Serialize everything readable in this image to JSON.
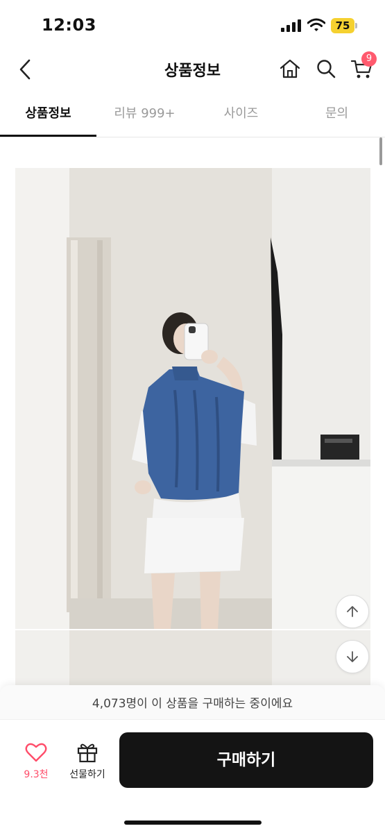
{
  "status_bar": {
    "time": "12:03",
    "battery": "75",
    "icons": [
      "signal-icon",
      "wifi-icon",
      "battery-icon"
    ]
  },
  "header": {
    "title": "상품정보",
    "cart_badge": "9",
    "icons": [
      "back-icon",
      "home-icon",
      "search-icon",
      "cart-icon"
    ]
  },
  "tabs": [
    {
      "label": "상품정보",
      "active": true
    },
    {
      "label": "리뷰 999+",
      "active": false
    },
    {
      "label": "사이즈",
      "active": false
    },
    {
      "label": "문의",
      "active": false
    }
  ],
  "bottom_bar": {
    "purchase_notice": "4,073명이 이 상품을 구매하는 중이에요",
    "like_count": "9.3천",
    "gift_label": "선물하기",
    "buy_label": "구매하기"
  },
  "colors": {
    "accent_pink": "#ff5a6e",
    "buy_button": "#141414",
    "battery": "#f5d130",
    "vest_blue": "#3d64a0"
  }
}
